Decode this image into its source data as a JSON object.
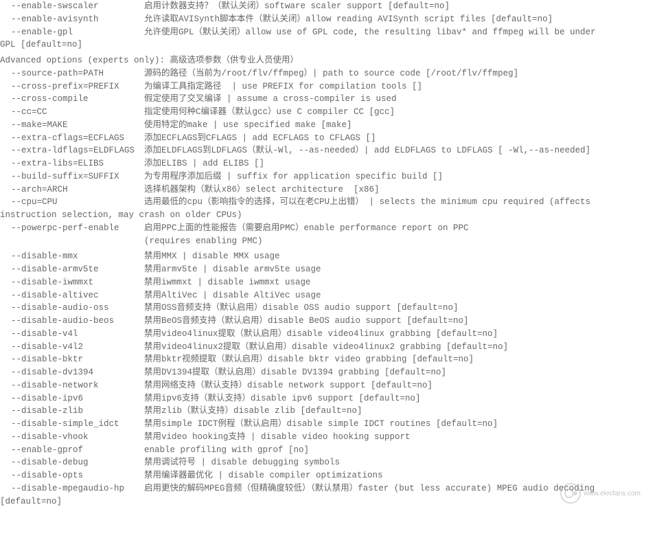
{
  "options": [
    {
      "flag": "--enable-swscaler",
      "desc": "启用计数器支持？（默认关闭）software scaler support [default=no]"
    },
    {
      "flag": "--enable-avisynth",
      "desc": "允许读取AVISynth脚本本件（默认关闭）allow reading AVISynth script files [default=no]"
    },
    {
      "flag": "--enable-gpl",
      "desc": "允许使用GPL（默认关闭）allow use of GPL code, the resulting libav* and ffmpeg will be under"
    }
  ],
  "wrap1": "GPL [default=no]",
  "section_header": "Advanced options (experts only): 高级选项参数（供专业人员使用）",
  "adv": [
    {
      "flag": "--source-path=PATH",
      "desc": "源码的路径（当前为/root/flv/ffmpeg）| path to source code [/root/flv/ffmpeg]"
    },
    {
      "flag": "--cross-prefix=PREFIX",
      "desc": "为编译工具指定路径  | use PREFIX for compilation tools []"
    },
    {
      "flag": "--cross-compile",
      "desc": "假定使用了交叉编译 | assume a cross-compiler is used"
    },
    {
      "flag": "--cc=CC",
      "desc": "指定使用何种C编译器（默认gcc）use C compiler CC [gcc]"
    },
    {
      "flag": "--make=MAKE",
      "desc": "使用特定的make | use specified make [make]"
    },
    {
      "flag": "--extra-cflags=ECFLAGS",
      "desc": "添加ECFLAGS到CFLAGS | add ECFLAGS to CFLAGS []"
    },
    {
      "flag": "--extra-ldflags=ELDFLAGS",
      "desc": "添加ELDFLAGS到LDFLAGS（默认-Wl, --as-needed）| add ELDFLAGS to LDFLAGS [ -Wl,--as-needed]"
    },
    {
      "flag": "--extra-libs=ELIBS",
      "desc": "添加ELIBS | add ELIBS []"
    },
    {
      "flag": "--build-suffix=SUFFIX",
      "desc": "为专用程序添加后缀 | suffix for application specific build []"
    },
    {
      "flag": "--arch=ARCH",
      "desc": "选择机器架构（默认x86）select architecture  [x86]"
    },
    {
      "flag": "--cpu=CPU",
      "desc": "选用最低的cpu（影响指令的选择，可以在老CPU上出错） | selects the minimum cpu required (affects"
    }
  ],
  "wrap2": "instruction selection, may crash on older CPUs)",
  "ppc": {
    "flag": "--powerpc-perf-enable",
    "desc": "启用PPC上面的性能报告（需要启用PMC）enable performance report on PPC"
  },
  "ppc_cont": {
    "flag": "",
    "desc": "(requires enabling PMC)"
  },
  "adv2": [
    {
      "flag": "--disable-mmx",
      "desc": "禁用MMX | disable MMX usage"
    },
    {
      "flag": "--disable-armv5te",
      "desc": "禁用armv5te | disable armv5te usage"
    },
    {
      "flag": "--disable-iwmmxt",
      "desc": "禁用iwmmxt | disable iwmmxt usage"
    },
    {
      "flag": "--disable-altivec",
      "desc": "禁用AltiVec | disable AltiVec usage"
    },
    {
      "flag": "--disable-audio-oss",
      "desc": "禁用OSS音频支持（默认启用）disable OSS audio support [default=no]"
    },
    {
      "flag": "--disable-audio-beos",
      "desc": "禁用BeOS音频支持（默认启用）disable BeOS audio support [default=no]"
    },
    {
      "flag": "--disable-v4l",
      "desc": "禁用video4linux提取（默认启用）disable video4linux grabbing [default=no]"
    },
    {
      "flag": "--disable-v4l2",
      "desc": "禁用video4linux2提取（默认启用）disable video4linux2 grabbing [default=no]"
    },
    {
      "flag": "--disable-bktr",
      "desc": "禁用bktr视频提取（默认启用）disable bktr video grabbing [default=no]"
    },
    {
      "flag": "--disable-dv1394",
      "desc": "禁用DV1394提取（默认启用）disable DV1394 grabbing [default=no]"
    },
    {
      "flag": "--disable-network",
      "desc": "禁用网络支持（默认支持）disable network support [default=no]"
    },
    {
      "flag": "--disable-ipv6",
      "desc": "禁用ipv6支持（默认支持）disable ipv6 support [default=no]"
    },
    {
      "flag": "--disable-zlib",
      "desc": "禁用zlib（默认支持）disable zlib [default=no]"
    },
    {
      "flag": "--disable-simple_idct",
      "desc": "禁用simple IDCT例程（默认启用）disable simple IDCT routines [default=no]"
    },
    {
      "flag": "--disable-vhook",
      "desc": "禁用video hooking支持 | disable video hooking support"
    },
    {
      "flag": "--enable-gprof",
      "desc": "enable profiling with gprof [no]"
    },
    {
      "flag": "--disable-debug",
      "desc": "禁用调试符号 | disable debugging symbols"
    },
    {
      "flag": "--disable-opts",
      "desc": "禁用编译器最优化 | disable compiler optimizations"
    },
    {
      "flag": "--disable-mpegaudio-hp",
      "desc": "启用更快的解码MPEG音频（但精确度较低）（默认禁用）faster (but less accurate) MPEG audio decoding"
    }
  ],
  "wrap3": "[default=no]",
  "watermark": "www.elecfans.com"
}
